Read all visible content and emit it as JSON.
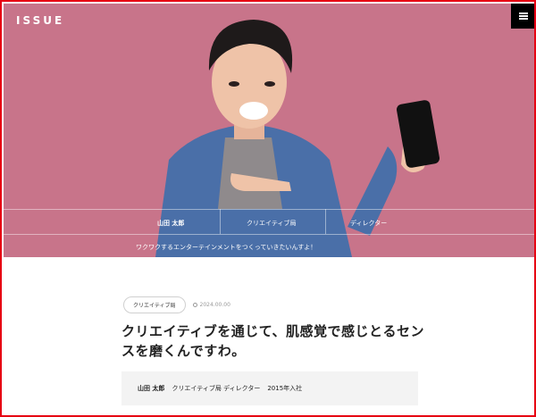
{
  "header": {
    "logo": "ISSUE",
    "menu_icon": "hamburger-icon"
  },
  "hero": {
    "name": "山田 太郎",
    "department": "クリエイティブ局",
    "role": "ディレクター",
    "caption": "ワクワクするエンターテインメントをつくっていきたいんすよ！"
  },
  "article": {
    "category": "クリエイティブ局",
    "date": "2024.00.00",
    "title": "クリエイティブを通じて、肌感覚で感じとるセンスを磨くんですわ。",
    "profile": {
      "name": "山田 太郎",
      "position": "クリエイティブ局 ディレクター",
      "joined": "2015年入社"
    }
  },
  "colors": {
    "accent_border": "#e60012",
    "hero_bg": "#c8748a"
  }
}
